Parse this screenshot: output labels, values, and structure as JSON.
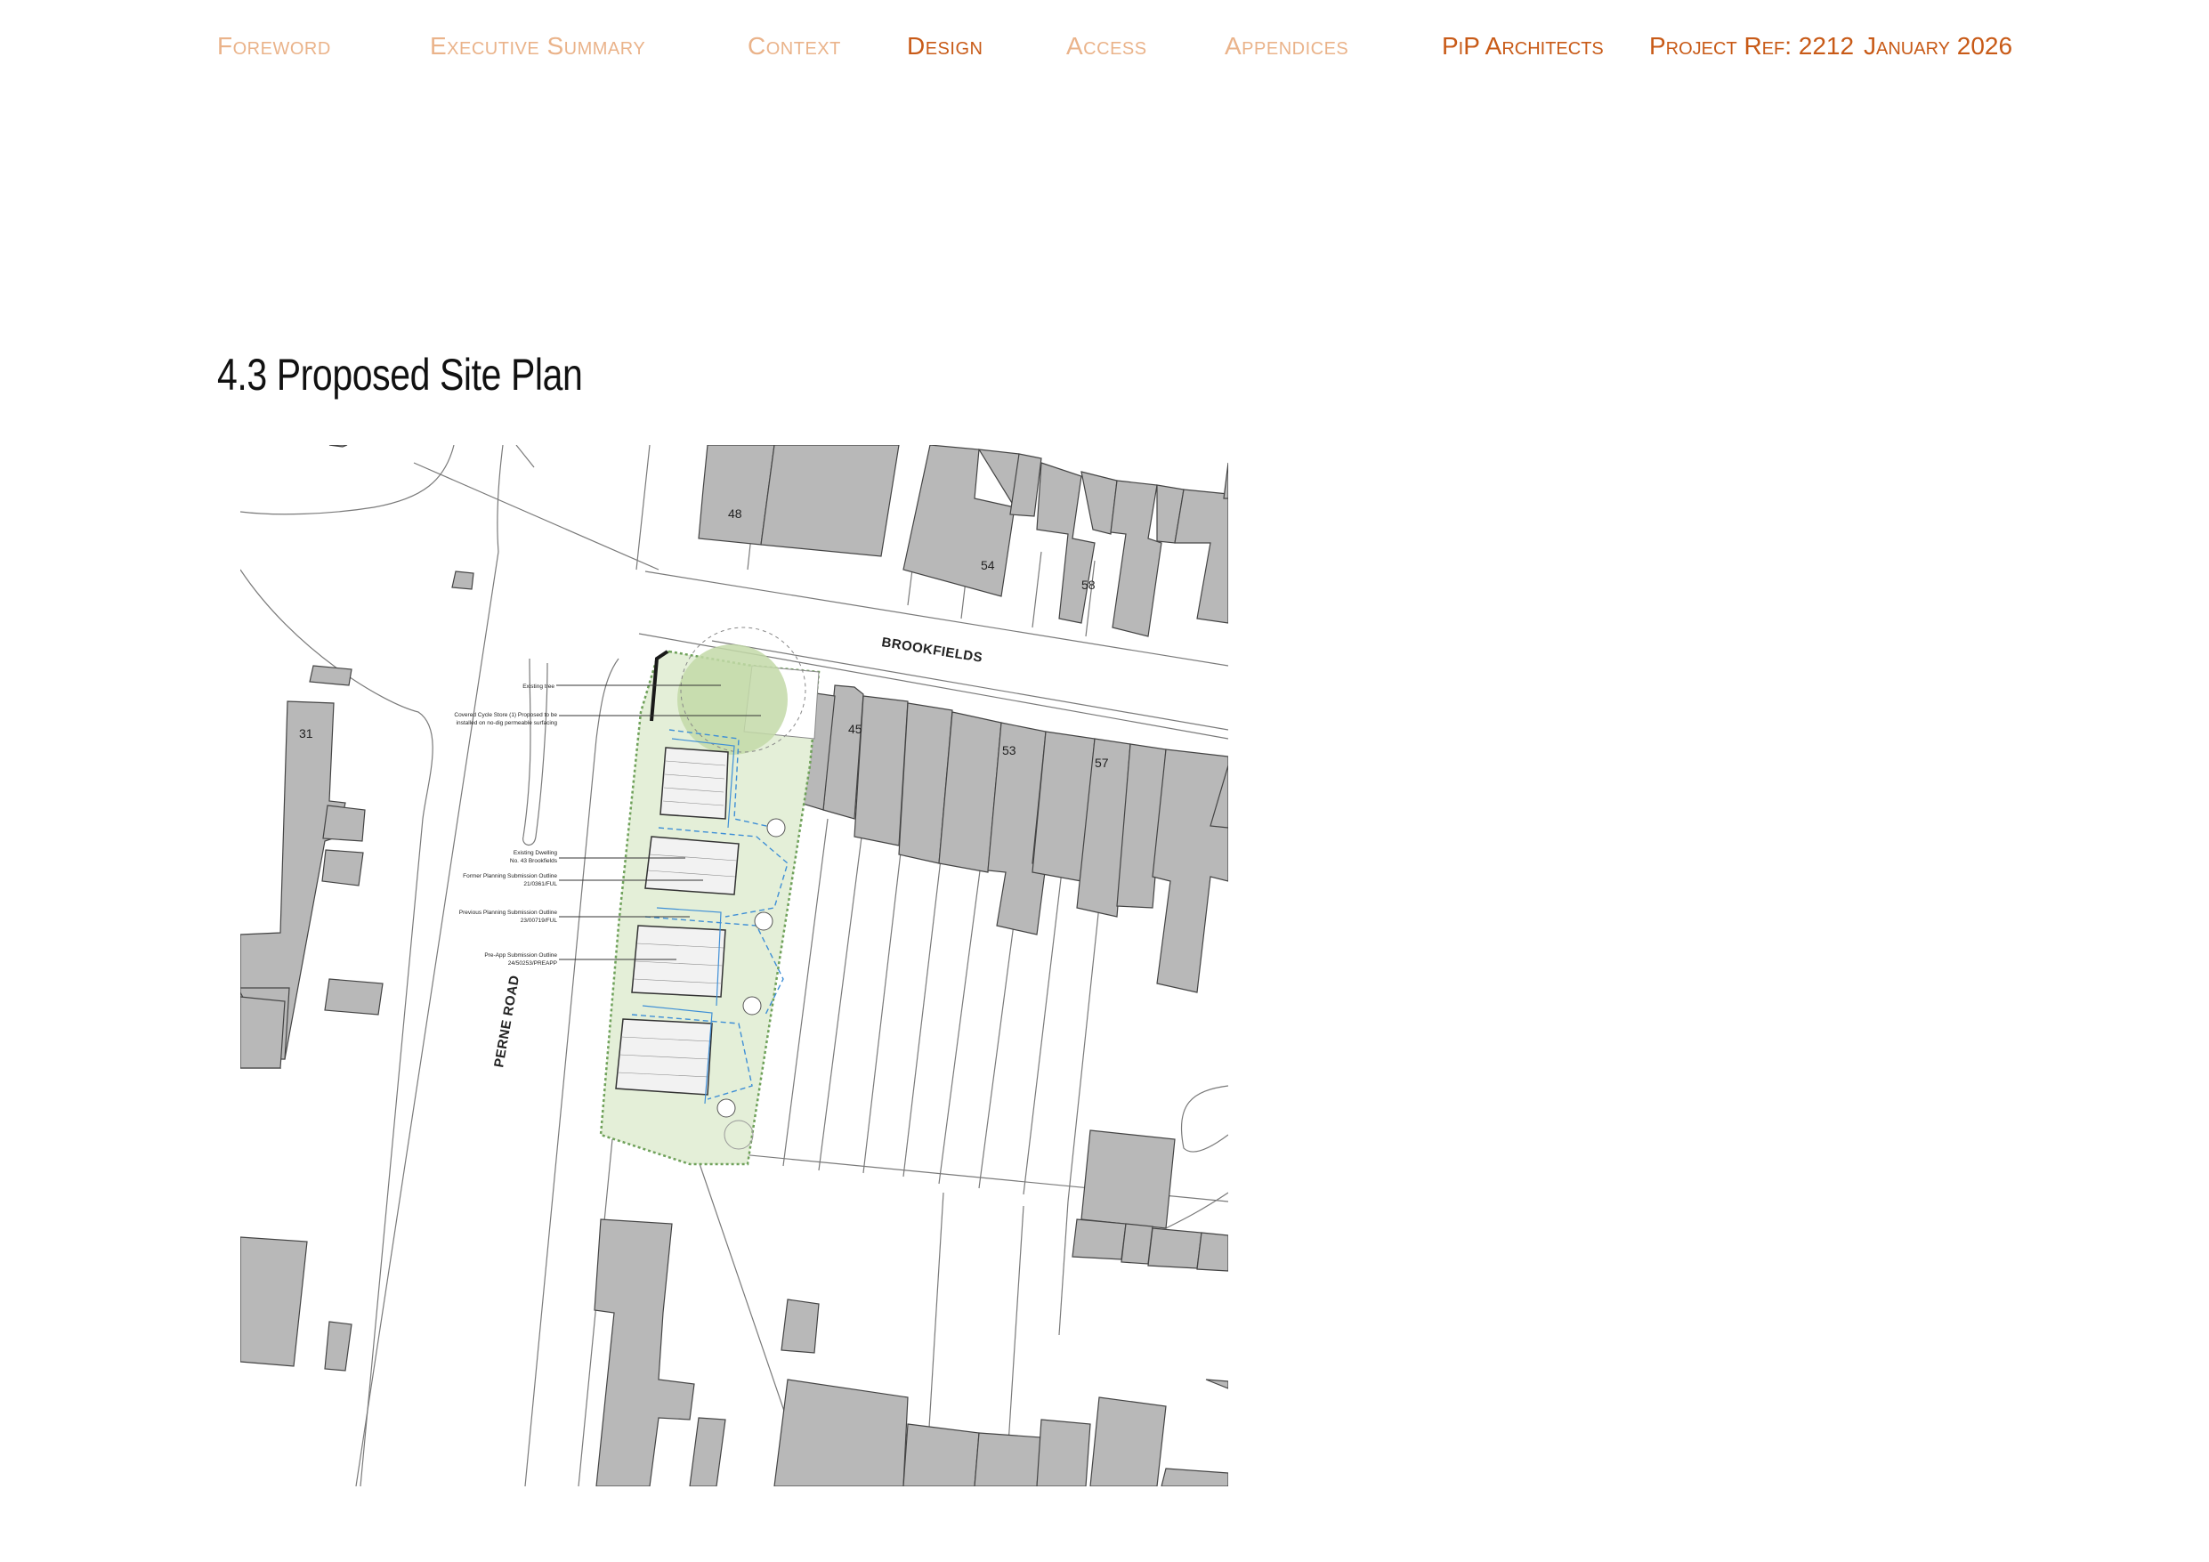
{
  "nav": {
    "items": [
      {
        "label": "Foreword",
        "active": false
      },
      {
        "label": "Executive Summary",
        "active": false
      },
      {
        "label": "Context",
        "active": false
      },
      {
        "label": "Design",
        "active": true
      },
      {
        "label": "Access",
        "active": false
      },
      {
        "label": "Appendices",
        "active": false
      }
    ],
    "company": "PiP Architects",
    "project_ref": "Project Ref: 2212",
    "date": "January 2026"
  },
  "page": {
    "title": "4.3 Proposed Site Plan"
  },
  "site_plan": {
    "streets": [
      "BROOKFIELDS",
      "PERNE ROAD"
    ],
    "house_numbers": [
      "48",
      "54",
      "58",
      "45",
      "53",
      "57",
      "31"
    ],
    "annotations": [
      {
        "lines": [
          "Existing tree"
        ]
      },
      {
        "lines": [
          "Covered Cycle Store (1) Proposed to be",
          "installed on no-dig permeable surfacing"
        ]
      },
      {
        "lines": [
          "Existing Dwelling",
          "No. 43 Brookfields"
        ]
      },
      {
        "lines": [
          "Former Planning Submission Outline",
          "21/0361/FUL"
        ]
      },
      {
        "lines": [
          "Previous Planning Submission Outline",
          "23/00719/FUL"
        ]
      },
      {
        "lines": [
          "Pre-App Submission Outline",
          "24/50253/PREAPP"
        ]
      }
    ],
    "colors": {
      "building": "#b8b8b8",
      "site_green": "#e4efd8",
      "tree": "#c3d9a8",
      "accent": "#c85a17",
      "nav_muted": "#eab38a",
      "outline_blue": "#3f8fd6"
    }
  }
}
